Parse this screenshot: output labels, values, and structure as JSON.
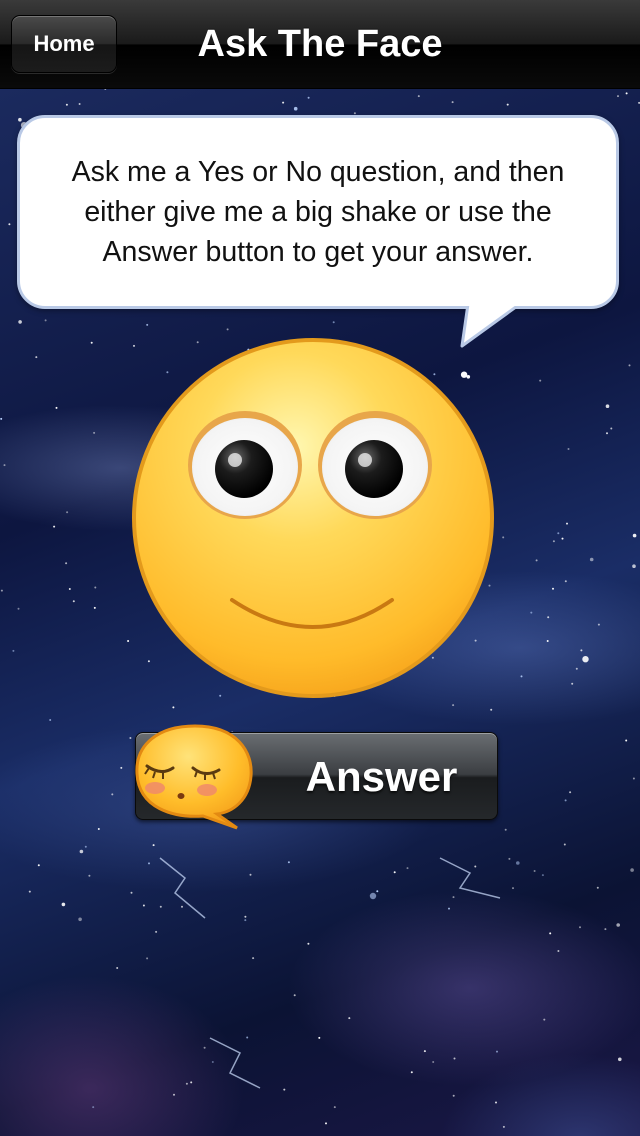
{
  "navbar": {
    "home_label": "Home",
    "title": "Ask The Face"
  },
  "bubble": {
    "text": "Ask me a Yes or No question, and then either give me a big shake or use the Answer button to get your answer."
  },
  "answer_button": {
    "label": "Answer"
  },
  "icons": {
    "big_face": "smiley-face-icon",
    "small_face": "shy-face-icon"
  },
  "colors": {
    "face_yellow": "#ffc93c",
    "face_outline": "#e39a1c",
    "bubble_border": "#b9c9e6",
    "cheek": "#f08a6a"
  }
}
